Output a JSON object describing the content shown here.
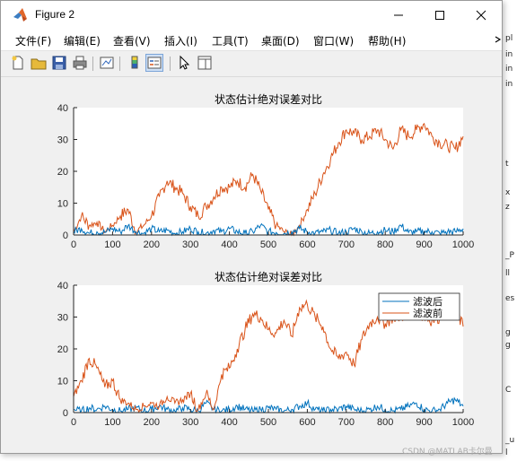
{
  "window": {
    "title": "Figure 2"
  },
  "menu": {
    "file": "文件(F)",
    "edit": "编辑(E)",
    "view": "查看(V)",
    "insert": "插入(I)",
    "tools": "工具(T)",
    "desktop": "桌面(D)",
    "window": "窗口(W)",
    "help": "帮助(H)"
  },
  "toolbar": [
    "new-figure-icon",
    "open-file-icon",
    "save-icon",
    "print-icon",
    "link-plot-icon",
    "colorbar-icon",
    "legend-icon",
    "pointer-icon",
    "property-editor-icon"
  ],
  "background_text": [
    "pl",
    "in",
    "in",
    "in",
    "t",
    "x",
    "z",
    "_P",
    "ll",
    "es",
    "g",
    "g",
    "C",
    "_u",
    "l"
  ],
  "watermark": "CSDN @MATLAB卡尔曼",
  "colors": {
    "before": "#d95319",
    "after": "#0072bd",
    "axes_bg": "#ffffff",
    "figure_bg": "#f0f0f0"
  },
  "chart_data": [
    {
      "type": "line",
      "title": "状态估计绝对误差对比",
      "xlim": [
        0,
        1000
      ],
      "ylim": [
        0,
        40
      ],
      "xticks": [
        0,
        100,
        200,
        300,
        400,
        500,
        600,
        700,
        800,
        900,
        1000
      ],
      "yticks": [
        0,
        10,
        20,
        30,
        40
      ],
      "legend": null,
      "series": [
        {
          "x": [
            0,
            20,
            40,
            60,
            80,
            100,
            120,
            140,
            160,
            180,
            200,
            220,
            240,
            260,
            280,
            300,
            320,
            340,
            360,
            380,
            400,
            420,
            440,
            460,
            480,
            500,
            520,
            540,
            560,
            580,
            600,
            620,
            640,
            660,
            680,
            700,
            720,
            740,
            760,
            780,
            800,
            820,
            840,
            860,
            880,
            900,
            920,
            940,
            960,
            980,
            1000
          ],
          "values": [
            1,
            6,
            3,
            4,
            1,
            3,
            6,
            8,
            1,
            3,
            6,
            12,
            17,
            15,
            13,
            9,
            6,
            9,
            12,
            15,
            15,
            17,
            15,
            19,
            14,
            8,
            3,
            1,
            0,
            3,
            8,
            13,
            19,
            24,
            29,
            33,
            32,
            30,
            31,
            33,
            30,
            27,
            33,
            31,
            33,
            35,
            31,
            29,
            28,
            27,
            31
          ]
        },
        {
          "x": [
            0,
            20,
            40,
            60,
            80,
            100,
            120,
            140,
            160,
            180,
            200,
            220,
            240,
            260,
            280,
            300,
            320,
            340,
            360,
            380,
            400,
            420,
            440,
            460,
            480,
            500,
            520,
            540,
            560,
            580,
            600,
            620,
            640,
            660,
            680,
            700,
            720,
            740,
            760,
            780,
            800,
            820,
            840,
            860,
            880,
            900,
            920,
            940,
            960,
            980,
            1000
          ],
          "values": [
            1,
            2,
            0.5,
            1,
            0.8,
            2,
            1,
            3,
            1,
            0.5,
            2,
            1,
            1.5,
            0.5,
            1,
            2,
            1,
            0.5,
            1.5,
            1,
            2,
            1,
            0.5,
            1,
            3,
            1,
            0.8,
            0.5,
            1,
            2,
            1,
            0.6,
            1,
            1.5,
            0.5,
            1,
            2,
            1,
            0.5,
            1,
            1.5,
            1,
            3,
            0.8,
            1,
            1.2,
            1,
            0.5,
            1,
            1,
            2
          ]
        }
      ]
    },
    {
      "type": "line",
      "title": "状态估计绝对误差对比",
      "xlim": [
        0,
        1000
      ],
      "ylim": [
        0,
        40
      ],
      "xticks": [
        0,
        100,
        200,
        300,
        400,
        500,
        600,
        700,
        800,
        900,
        1000
      ],
      "yticks": [
        0,
        10,
        20,
        30,
        40
      ],
      "legend": "top-right",
      "series": [
        {
          "name": "滤波后",
          "x": [
            0,
            20,
            40,
            60,
            80,
            100,
            120,
            140,
            160,
            180,
            200,
            220,
            240,
            260,
            280,
            300,
            320,
            340,
            360,
            380,
            400,
            420,
            440,
            460,
            480,
            500,
            520,
            540,
            560,
            580,
            600,
            620,
            640,
            660,
            680,
            700,
            720,
            740,
            760,
            780,
            800,
            820,
            840,
            860,
            880,
            900,
            920,
            940,
            960,
            980,
            1000
          ],
          "values": [
            1,
            0.5,
            1.5,
            1,
            2,
            1,
            0.5,
            1,
            1.5,
            0.5,
            1,
            2,
            1,
            0.5,
            1.5,
            1,
            0.5,
            3,
            1,
            0.5,
            1,
            2,
            1,
            0.5,
            1,
            1.5,
            1,
            0.5,
            1,
            2,
            3,
            1,
            0.5,
            1,
            1,
            2,
            1,
            0.5,
            1,
            2,
            1,
            0.5,
            1,
            2,
            3,
            1,
            0.5,
            1,
            3,
            4,
            2
          ]
        },
        {
          "name": "滤波前",
          "x": [
            0,
            20,
            40,
            60,
            80,
            100,
            120,
            140,
            160,
            180,
            200,
            220,
            240,
            260,
            280,
            300,
            320,
            340,
            360,
            380,
            400,
            420,
            440,
            460,
            480,
            500,
            520,
            540,
            560,
            580,
            600,
            620,
            640,
            660,
            680,
            700,
            720,
            740,
            760,
            780,
            800,
            820,
            840,
            860,
            880,
            900,
            920,
            940,
            960,
            980,
            1000
          ],
          "values": [
            5,
            10,
            17,
            14,
            8,
            10,
            4,
            3,
            1,
            2,
            3,
            2,
            5,
            3,
            4,
            6,
            1,
            6,
            1,
            12,
            14,
            20,
            26,
            31,
            30,
            26,
            25,
            29,
            24,
            33,
            34,
            30,
            27,
            20,
            17,
            19,
            15,
            23,
            28,
            30,
            28,
            30,
            30,
            32,
            31,
            30,
            29,
            30,
            33,
            32,
            27
          ]
        }
      ]
    }
  ]
}
